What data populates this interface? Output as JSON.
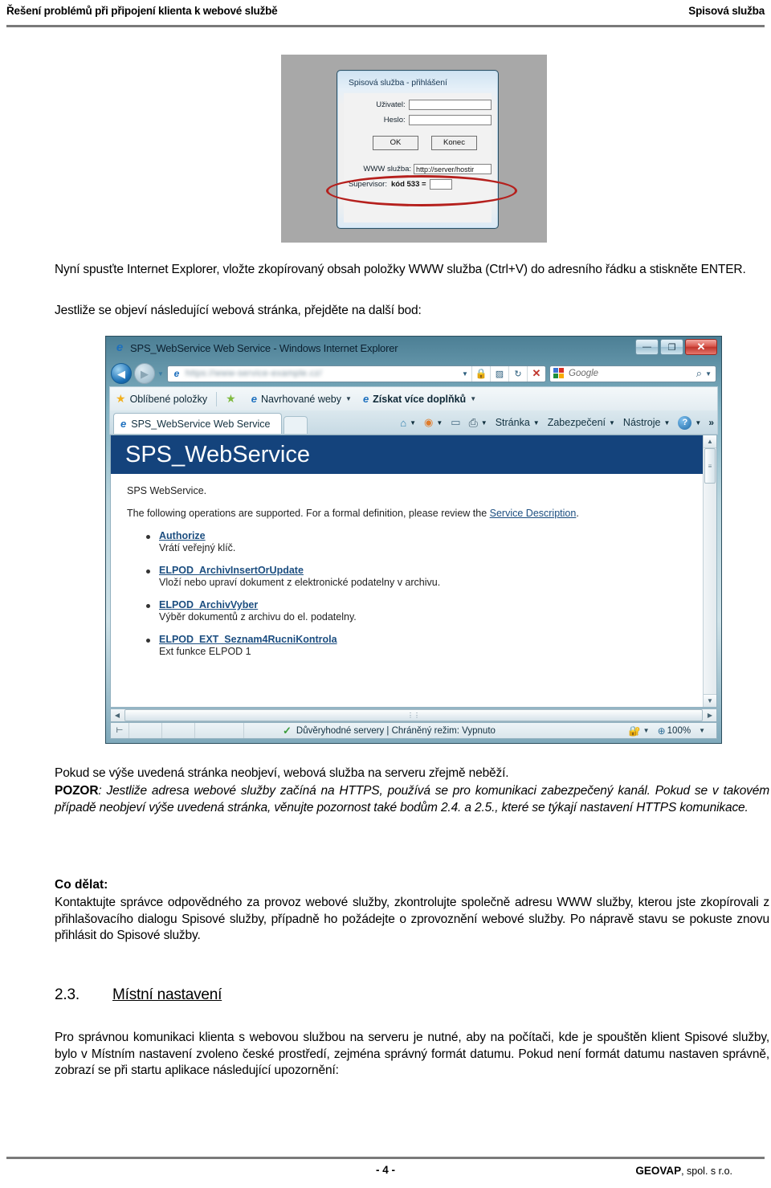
{
  "header": {
    "left": "Řešení problémů při připojení klienta k webové službě",
    "right": "Spisová služba"
  },
  "login_screenshot": {
    "dialog_title": "Spisová služba - přihlášení",
    "fields": {
      "user_label": "Uživatel:",
      "user_value": "",
      "password_label": "Heslo:",
      "password_value": "",
      "www_label": "WWW služba:",
      "www_value": "http://server/hostir",
      "supervisor_label": "Supervisor:",
      "supervisor_code": "kód 533 =",
      "supervisor_value": ""
    },
    "buttons": {
      "ok": "OK",
      "cancel": "Konec"
    },
    "annotation_color": "#b5201d"
  },
  "body": {
    "intro1": "Nyní spusťte Internet Explorer, vložte zkopírovaný obsah položky WWW služba (Ctrl+V) do adresního řádku a stiskněte ENTER.",
    "intro2": "Jestliže se objeví následující webová stránka, přejděte na další bod:",
    "after_shot": "Pokud se výše uvedená stránka neobjeví, webová služba na serveru zřejmě neběží.",
    "pozor_label": "POZOR",
    "pozor_text": ": Jestliže adresa webové služby začíná na HTTPS, používá se pro komunikaci zabezpečený kanál. Pokud se v takovém případě neobjeví výše uvedená stránka, věnujte pozornost také bodům 2.4. a 2.5., které se týkají nastavení HTTPS komunikace.",
    "codelat_heading": "Co dělat:",
    "codelat_text": "Kontaktujte správce odpovědného za provoz webové služby, zkontrolujte společně adresu WWW služby, kterou jste zkopírovali z přihlašovacího dialogu Spisové služby, případně ho požádejte o zprovoznění webové služby. Po nápravě stavu se pokuste znovu přihlásit do Spisové služby.",
    "section_number": "2.3.",
    "section_title": "Místní nastavení",
    "section_text": "Pro správnou komunikaci klienta s webovou službou na serveru je nutné, aby na počítači, kde je spouštěn klient Spisové služby, bylo v Místním nastavení zvoleno české prostředí, zejména správný formát datumu. Pokud není formát datumu nastaven správně, zobrazí se při startu aplikace následující upozornění:"
  },
  "browser_screenshot": {
    "window_title": "SPS_WebService Web Service - Windows Internet Explorer",
    "window_buttons": {
      "minimize": "—",
      "maximize": "❐",
      "close": "✕"
    },
    "address_bar": {
      "url": "https://www-service-example.cz/",
      "url_blurred": true
    },
    "search_box": {
      "provider": "Google",
      "placeholder": "Google"
    },
    "favorites_bar": [
      {
        "label": "Oblíbené položky",
        "icon": "star-icon",
        "caret": false
      },
      {
        "label": "Navrhované weby",
        "icon": "ie-icon",
        "caret": true
      },
      {
        "label": "Získat více doplňků",
        "icon": "ie-icon",
        "caret": true,
        "bold": true
      }
    ],
    "tab": {
      "label": "SPS_WebService Web Service"
    },
    "command_bar": [
      {
        "label": "",
        "icon": "home-icon",
        "caret": true
      },
      {
        "label": "",
        "icon": "rss-icon",
        "caret": true
      },
      {
        "label": "",
        "icon": "mail-icon",
        "caret": false
      },
      {
        "label": "",
        "icon": "print-icon",
        "caret": true
      },
      {
        "label": "Stránka",
        "icon": "",
        "caret": true
      },
      {
        "label": "Zabezpečení",
        "icon": "",
        "caret": true
      },
      {
        "label": "Nástroje",
        "icon": "",
        "caret": true
      },
      {
        "label": "",
        "icon": "help-icon",
        "caret": true
      }
    ],
    "command_overflow": "»",
    "page": {
      "banner_title": "SPS_WebService",
      "banner_color": "#14437c",
      "subtitle": "SPS WebService.",
      "description_prefix": "The following operations are supported. For a formal definition, please review the ",
      "description_link": "Service Description",
      "description_suffix": ".",
      "operations": [
        {
          "name": "Authorize",
          "desc": "Vrátí veřejný klíč."
        },
        {
          "name": "ELPOD_ArchivInsertOrUpdate",
          "desc": "Vloží nebo upraví dokument z elektronické podatelny v archivu."
        },
        {
          "name": "ELPOD_ArchivVyber",
          "desc": "Výběr dokumentů z archivu do el. podatelny."
        },
        {
          "name": "ELPOD_EXT_Seznam4RucniKontrola",
          "desc": "Ext funkce ELPOD 1"
        }
      ]
    },
    "status_bar": {
      "zone": "Důvěryhodné servery | Chráněný režim: Vypnuto",
      "zoom": "100%"
    }
  },
  "footer": {
    "page_number": "- 4 -",
    "company_bold": "GEOVAP",
    "company_rest": ", spol. s r.o."
  }
}
